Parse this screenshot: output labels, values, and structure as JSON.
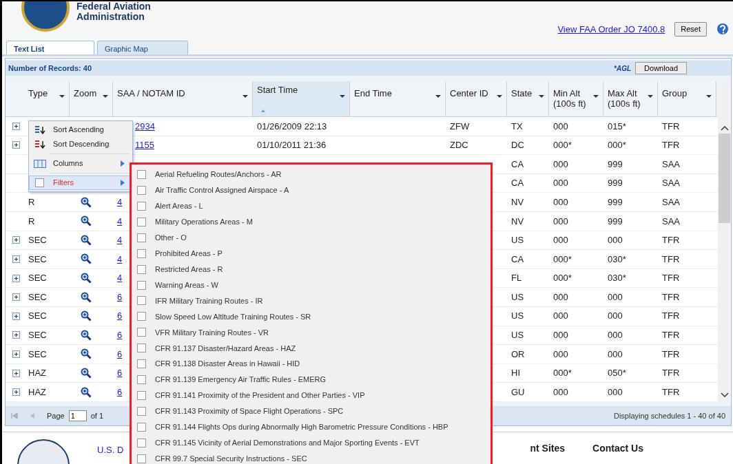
{
  "header": {
    "title_lines": [
      "Federal Aviation",
      "Administration"
    ],
    "order_link": "View FAA Order JO 7400.8",
    "reset_button": "Reset"
  },
  "tabs": [
    {
      "label": "Text List",
      "selected": true
    },
    {
      "label": "Graphic Map",
      "selected": false
    }
  ],
  "toolbar": {
    "records": "Number of Records: 40",
    "agl": "*AGL",
    "download_button": "Download"
  },
  "table": {
    "columns": [
      {
        "label": "Type",
        "sorted": false
      },
      {
        "label": "Zoom",
        "sorted": false
      },
      {
        "label": "SAA / NOTAM ID",
        "sorted": false
      },
      {
        "label": "Start Time",
        "sorted": true
      },
      {
        "label": "End Time",
        "sorted": false
      },
      {
        "label": "Center ID",
        "sorted": false
      },
      {
        "label": "State",
        "sorted": false
      },
      {
        "label": "Min Alt (100s ft)",
        "sorted": false
      },
      {
        "label": "Max Alt (100s ft)",
        "sorted": false
      },
      {
        "label": "Group",
        "sorted": false
      }
    ],
    "rows": [
      {
        "expandable": true,
        "zoom_icon": false,
        "id": "2934",
        "start": "01/26/2009 22:13",
        "center": "ZFW",
        "state": "TX",
        "min_alt": "000",
        "max_alt": "015*",
        "group": "TFR"
      },
      {
        "expandable": true,
        "zoom_icon": false,
        "id": "1155",
        "start": "01/10/2011 21:36",
        "center": "ZDC",
        "state": "DC",
        "min_alt": "000*",
        "max_alt": "000*",
        "group": "TFR"
      },
      {
        "expandable": false,
        "zoom_icon": false,
        "state": "CA",
        "min_alt": "000",
        "max_alt": "999",
        "group": "SAA"
      },
      {
        "expandable": false,
        "zoom_icon": false,
        "state": "CA",
        "min_alt": "000",
        "max_alt": "999",
        "group": "SAA"
      },
      {
        "expandable": false,
        "type": "R",
        "zoom_icon": true,
        "id": "4",
        "state": "NV",
        "min_alt": "000",
        "max_alt": "999",
        "group": "SAA"
      },
      {
        "expandable": false,
        "type": "R",
        "zoom_icon": true,
        "id": "4",
        "state": "NV",
        "min_alt": "000",
        "max_alt": "999",
        "group": "SAA"
      },
      {
        "expandable": true,
        "type": "SEC",
        "zoom_icon": true,
        "id": "4",
        "state": "US",
        "min_alt": "000",
        "max_alt": "000",
        "group": "TFR"
      },
      {
        "expandable": true,
        "type": "SEC",
        "zoom_icon": true,
        "id": "4",
        "state": "CA",
        "min_alt": "000*",
        "max_alt": "030*",
        "group": "TFR"
      },
      {
        "expandable": true,
        "type": "SEC",
        "zoom_icon": true,
        "id": "4",
        "state": "FL",
        "min_alt": "000*",
        "max_alt": "030*",
        "group": "TFR"
      },
      {
        "expandable": true,
        "type": "SEC",
        "zoom_icon": true,
        "id": "6",
        "state": "US",
        "min_alt": "000",
        "max_alt": "000",
        "group": "TFR"
      },
      {
        "expandable": true,
        "type": "SEC",
        "zoom_icon": true,
        "id": "6",
        "state": "US",
        "min_alt": "000",
        "max_alt": "000",
        "group": "TFR"
      },
      {
        "expandable": true,
        "type": "SEC",
        "zoom_icon": true,
        "id": "6",
        "state": "US",
        "min_alt": "000",
        "max_alt": "000",
        "group": "TFR"
      },
      {
        "expandable": true,
        "type": "SEC",
        "zoom_icon": true,
        "id": "6",
        "state": "OR",
        "min_alt": "000",
        "max_alt": "000",
        "group": "TFR"
      },
      {
        "expandable": true,
        "type": "HAZ",
        "zoom_icon": true,
        "id": "6",
        "state": "HI",
        "min_alt": "000*",
        "max_alt": "050*",
        "group": "TFR"
      },
      {
        "expandable": true,
        "type": "HAZ",
        "zoom_icon": true,
        "id": "6",
        "state": "GU",
        "min_alt": "000",
        "max_alt": "000",
        "group": "TFR"
      }
    ]
  },
  "column_menu": [
    {
      "kind": "sort-asc",
      "label": "Sort Ascending",
      "highlighted": false
    },
    {
      "kind": "sort-desc",
      "label": "Sort Descending",
      "highlighted": false
    },
    {
      "kind": "columns",
      "label": "Columns",
      "highlighted": false
    },
    {
      "kind": "filters",
      "label": "Filters",
      "highlighted": true,
      "checked": false
    }
  ],
  "filter_menu": [
    {
      "label": "Aerial Refueling Routes/Anchors - AR",
      "checked": false
    },
    {
      "label": "Air Traffic Control Assigned Airspace - A",
      "checked": false
    },
    {
      "label": "Alert Areas - L",
      "checked": false
    },
    {
      "label": "Military Operations Areas - M",
      "checked": false
    },
    {
      "label": "Other - O",
      "checked": false
    },
    {
      "label": "Prohibited Areas - P",
      "checked": false
    },
    {
      "label": "Restricted Areas - R",
      "checked": false
    },
    {
      "label": "Warning Areas - W",
      "checked": false
    },
    {
      "label": "IFR Military Training Routes - IR",
      "checked": false
    },
    {
      "label": "Slow Speed Low Altitude Training Routes - SR",
      "checked": false
    },
    {
      "label": "VFR Military Training Routes - VR",
      "checked": false
    },
    {
      "label": "CFR 91.137 Disaster/Hazard Areas - HAZ",
      "checked": false
    },
    {
      "label": "CFR 91.138 Disaster Areas in Hawaii - HID",
      "checked": false
    },
    {
      "label": "CFR 91.139 Emergency Air Traffic Rules - EMERG",
      "checked": false
    },
    {
      "label": "CFR 91.141 Proximity of the President and Other Parties - VIP",
      "checked": false
    },
    {
      "label": "CFR 91.143 Proximity of Space Flight Operations - SPC",
      "checked": false
    },
    {
      "label": "CFR 91.144 Flights Ops during Abnormally High Barometric Pressure Conditions - HBP",
      "checked": false
    },
    {
      "label": "CFR 91.145 Vicinity of Aerial Demonstrations and Major Sporting Events - EVT",
      "checked": false
    },
    {
      "label": "CFR 99.7 Special Security Instructions - SEC",
      "checked": false
    }
  ],
  "pager": {
    "page_label": "Page",
    "page_value": "1",
    "of_label": "of 1",
    "display": "Displaying schedules 1 - 40 of 40"
  },
  "footer": {
    "dot_text": "U.S. D",
    "sites": "nt Sites",
    "contact": "Contact Us"
  }
}
